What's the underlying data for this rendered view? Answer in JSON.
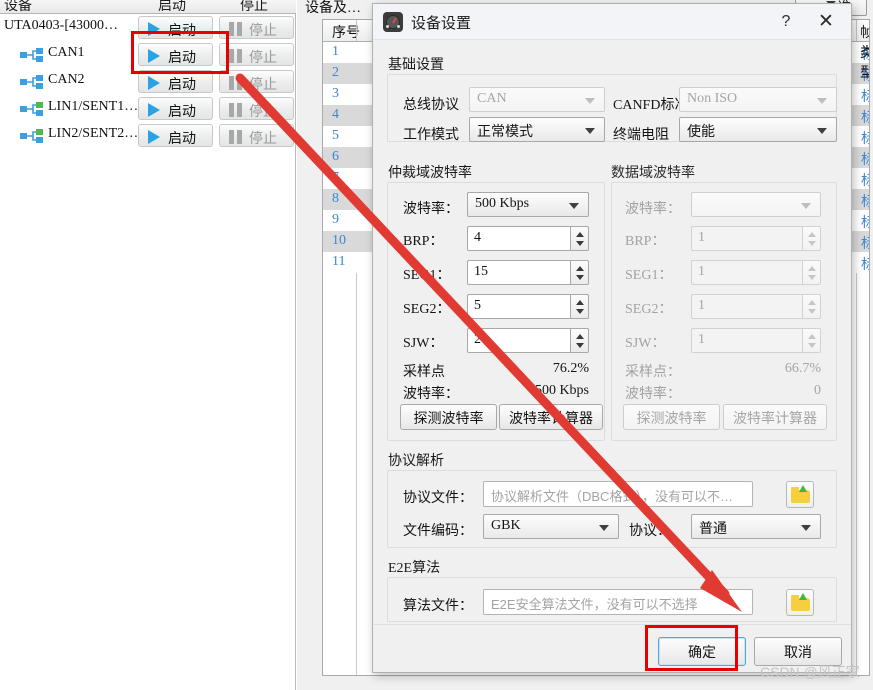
{
  "background": {
    "device_panel": {
      "headers": [
        "设备",
        "启动",
        "停止"
      ],
      "rows": [
        {
          "name": "UTA0403-[43000…",
          "icon": "",
          "indent": false,
          "start": "启动",
          "stop": "停止"
        },
        {
          "name": "CAN1",
          "icon": "can-bus-icon",
          "indent": true,
          "start": "启动",
          "stop": "停止"
        },
        {
          "name": "CAN2",
          "icon": "can-bus-icon",
          "indent": true,
          "start": "启动",
          "stop": "停止"
        },
        {
          "name": "LIN1/SENT1…",
          "icon": "lin-bus-icon",
          "indent": true,
          "start": "启动",
          "stop": "停止"
        },
        {
          "name": "LIN2/SENT2…",
          "icon": "lin-bus-icon",
          "indent": true,
          "start": "启动",
          "stop": "停止"
        }
      ]
    },
    "grid_panel": {
      "title": "设备及…",
      "columns": [
        "序号",
        "帧类型"
      ],
      "rows": [
        {
          "seq": "1",
          "type": "标…"
        },
        {
          "seq": "2",
          "type": "标…"
        },
        {
          "seq": "3",
          "type": "标…"
        },
        {
          "seq": "4",
          "type": "标…"
        },
        {
          "seq": "5",
          "type": "标…"
        },
        {
          "seq": "6",
          "type": "标…"
        },
        {
          "seq": "7",
          "type": "标…"
        },
        {
          "seq": "8",
          "type": "标…"
        },
        {
          "seq": "9",
          "type": "标…"
        },
        {
          "seq": "10",
          "type": "标…"
        },
        {
          "seq": "11",
          "type": "标…"
        }
      ]
    },
    "right_strip": {
      "label": "准"
    }
  },
  "dialog": {
    "title": "设备设置",
    "icon": "gauge-icon",
    "help_label": "?",
    "close_label": "✕",
    "basic": {
      "title": "基础设置",
      "bus_protocol_label": "总线协议",
      "bus_protocol_value": "CAN",
      "canfd_standard_label": "CANFD标准",
      "canfd_standard_value": "Non ISO",
      "work_mode_label": "工作模式",
      "work_mode_value": "正常模式",
      "terminal_resistor_label": "终端电阻",
      "terminal_resistor_value": "使能"
    },
    "arbitration": {
      "title": "仲裁域波特率",
      "baud_label": "波特率：",
      "baud_value": "500 Kbps",
      "brp_label": "BRP：",
      "brp_value": "4",
      "seg1_label": "SEG1：",
      "seg1_value": "15",
      "seg2_label": "SEG2：",
      "seg2_value": "5",
      "sjw_label": "SJW：",
      "sjw_value": "2",
      "sample_point_label": "采样点",
      "sample_point_value": "76.2%",
      "baudrate_ro_label": "波特率：",
      "baudrate_ro_value": "500 Kbps",
      "detect_button": "探测波特率",
      "calculator_button": "波特率计算器"
    },
    "data_field": {
      "title": "数据域波特率",
      "baud_label": "波特率：",
      "baud_value": "",
      "brp_label": "BRP：",
      "brp_value": "1",
      "seg1_label": "SEG1：",
      "seg1_value": "1",
      "seg2_label": "SEG2：",
      "seg2_value": "1",
      "sjw_label": "SJW：",
      "sjw_value": "1",
      "sample_point_label": "采样点：",
      "sample_point_value": "66.7%",
      "baudrate_ro_label": "波特率：",
      "baudrate_ro_value": "0",
      "detect_button": "探测波特率",
      "calculator_button": "波特率计算器"
    },
    "protocol": {
      "title": "协议解析",
      "file_label": "协议文件：",
      "file_placeholder": "协议解析文件（DBC格式），没有可以不…",
      "browse_icon": "open-folder-icon",
      "encoding_label": "文件编码：",
      "encoding_value": "GBK",
      "protocol_label": "协议：",
      "protocol_value": "普通"
    },
    "e2e": {
      "title": "E2E算法",
      "file_label": "算法文件：",
      "file_placeholder": "E2E安全算法文件，没有可以不选择",
      "browse_icon": "open-folder-icon"
    },
    "footer": {
      "ok_label": "确定",
      "cancel_label": "取消"
    }
  },
  "annotations": {
    "watermark": "CSDN @风正家",
    "highlight_color": "#e60000",
    "arrow_color": "#e03a32"
  }
}
